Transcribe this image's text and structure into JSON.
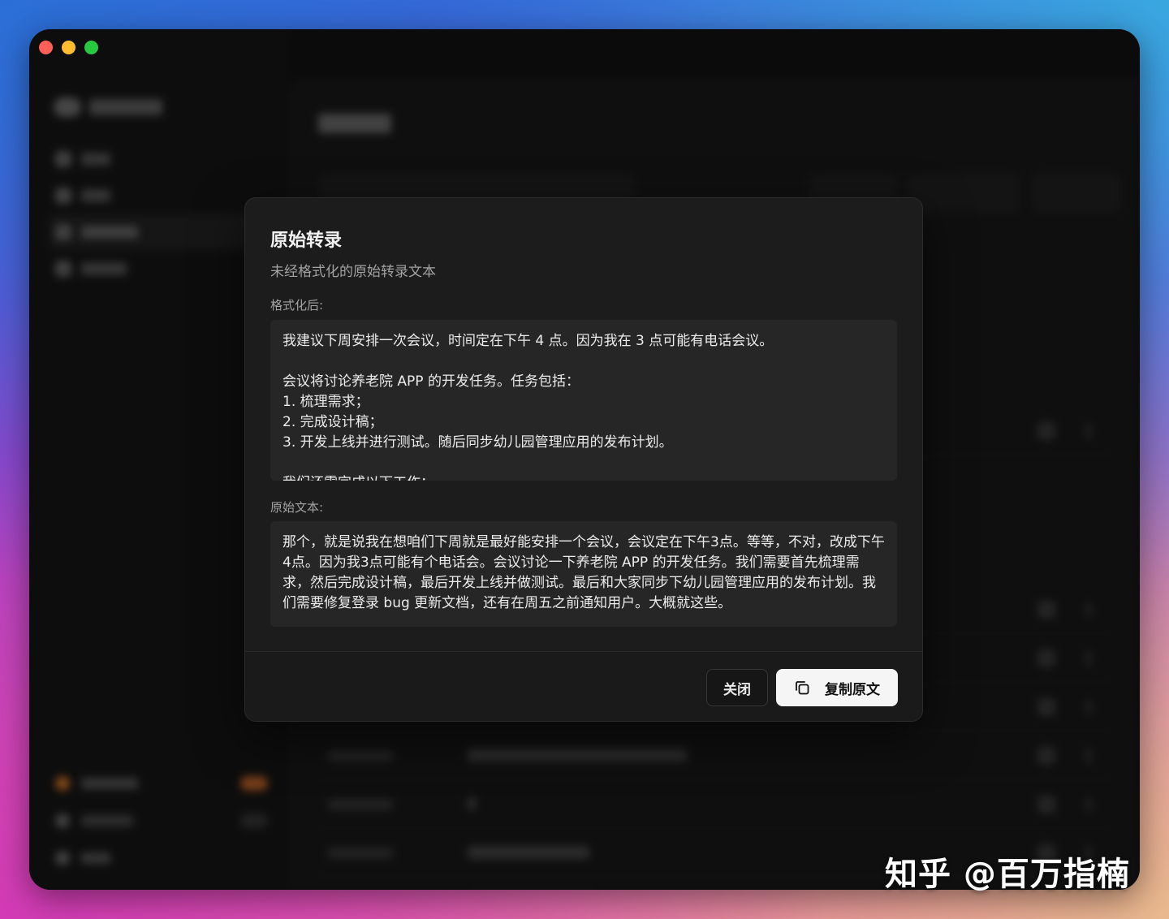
{
  "modal": {
    "title": "原始转录",
    "subtitle": "未经格式化的原始转录文本",
    "formatted_label": "格式化后:",
    "formatted_text": "我建议下周安排一次会议，时间定在下午 4 点。因为我在 3 点可能有电话会议。\n\n会议将讨论养老院 APP 的开发任务。任务包括：\n1. 梳理需求；\n2. 完成设计稿；\n3. 开发上线并进行测试。随后同步幼儿园管理应用的发布计划。\n\n我们还需完成以下工作：",
    "original_label": "原始文本:",
    "original_text": "那个，就是说我在想咱们下周就是最好能安排一个会议，会议定在下午3点。等等，不对，改成下午4点。因为我3点可能有个电话会。会议讨论一下养老院 APP 的开发任务。我们需要首先梳理需求，然后完成设计稿，最后开发上线并做测试。最后和大家同步下幼儿园管理应用的发布计划。我们需要修复登录 bug 更新文档，还有在周五之前通知用户。大概就这些。",
    "close_label": "关闭",
    "copy_label": "复制原文",
    "copy_icon": "copy-icon"
  },
  "watermark": "知乎 @百万指楠",
  "colors": {
    "modal_bg": "#1c1c1c",
    "box_bg": "#262626",
    "primary_button_bg": "#f5f5f5"
  }
}
